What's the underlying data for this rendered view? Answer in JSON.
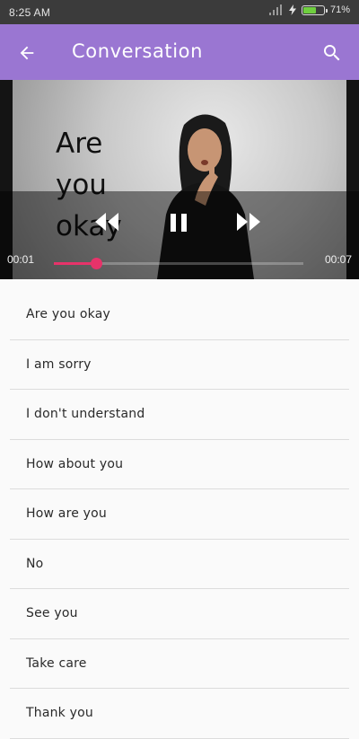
{
  "status_bar": {
    "time": "8:25 AM",
    "battery_percent": "71%",
    "battery_level": 0.71
  },
  "app_bar": {
    "title": "Conversation",
    "back_icon": "arrow-back-icon",
    "search_icon": "search-icon",
    "background_color": "#9a76d2"
  },
  "video": {
    "caption_lines": [
      "Are",
      "you",
      "okay"
    ],
    "current_time": "00:01",
    "total_time": "00:07",
    "progress": 0.17,
    "accent_color": "#e7336a"
  },
  "phrases": [
    {
      "label": "Are you okay"
    },
    {
      "label": "I am sorry"
    },
    {
      "label": "I don't understand"
    },
    {
      "label": "How about you"
    },
    {
      "label": "How are you"
    },
    {
      "label": "No"
    },
    {
      "label": "See you"
    },
    {
      "label": "Take care"
    },
    {
      "label": "Thank you"
    }
  ]
}
